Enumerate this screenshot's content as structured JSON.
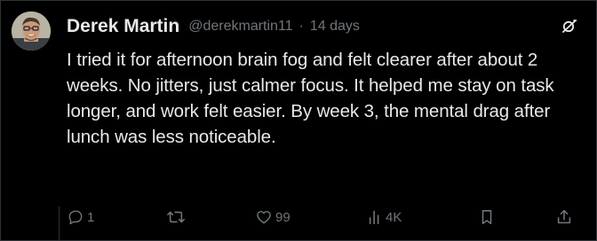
{
  "post": {
    "author_name": "Derek Martin",
    "handle": "@derekmartin11",
    "separator": "·",
    "time": "14 days",
    "text": "I tried it for afternoon brain fog and felt clearer after about 2 weeks. No jitters, just calmer focus. It helped me stay on task longer, and work felt easier. By week 3, the mental drag after lunch was less noticeable."
  },
  "actions": {
    "replies": "1",
    "reposts": "",
    "likes": "99",
    "views": "4K"
  },
  "icons": {
    "menu": "grok-icon",
    "reply": "reply-icon",
    "repost": "repost-icon",
    "like": "heart-icon",
    "views": "views-icon",
    "bookmark": "bookmark-icon",
    "share": "share-icon"
  },
  "colors": {
    "background": "#000000",
    "text_primary": "#e7e9ea",
    "text_secondary": "#71767b",
    "border": "#2f3336"
  }
}
